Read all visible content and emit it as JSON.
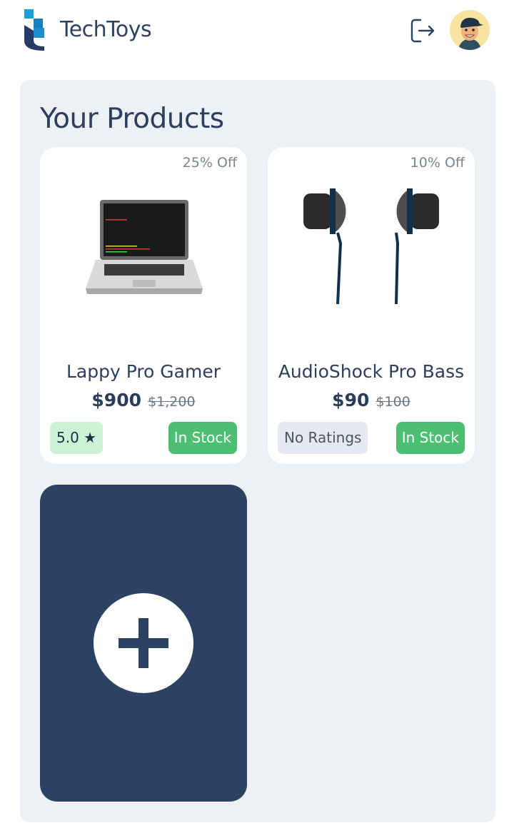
{
  "header": {
    "brand": "TechToys",
    "logout_icon": "logout-icon",
    "avatar_icon": "avatar-icon"
  },
  "main": {
    "title": "Your Products",
    "products": [
      {
        "name": "Lappy Pro Gamer",
        "discount": "25% Off",
        "price": "$900",
        "original_price": "$1,200",
        "rating": "5.0 ★",
        "stock": "In Stock",
        "image_icon": "laptop-icon"
      },
      {
        "name": "AudioShock Pro Bass",
        "discount": "10% Off",
        "price": "$90",
        "original_price": "$100",
        "rating": "No Ratings",
        "stock": "In Stock",
        "image_icon": "earphones-icon"
      }
    ],
    "add_icon": "plus-icon"
  },
  "colors": {
    "primary": "#2c4263",
    "accent_blue": "#1b98c9",
    "in_stock": "#4dbf73",
    "rating_bg": "#cdf3d6",
    "panel_bg": "#edf1f6"
  }
}
